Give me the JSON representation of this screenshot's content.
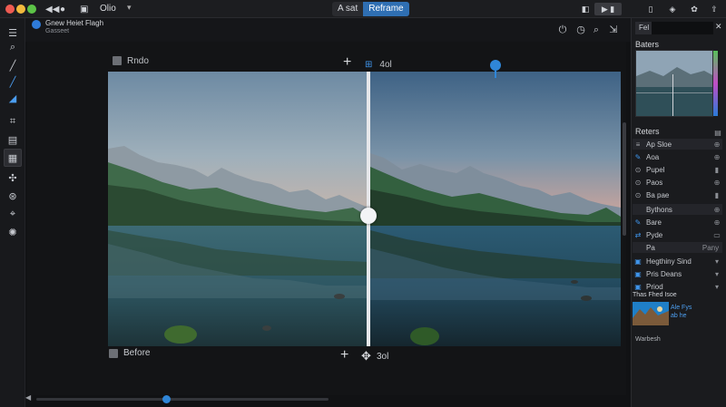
{
  "titlebar": {
    "app_name": "Olio",
    "segmented": [
      "A sat",
      "Reframe"
    ]
  },
  "document": {
    "title": "Gnew Heiet Flagh",
    "subtitle": "Gasseet"
  },
  "canvas": {
    "before_label_top": "Rndo",
    "after_label_top": "4ol",
    "before_label_bottom": "Before",
    "after_label_bottom": "3ol"
  },
  "right_panel": {
    "tab_label": "Fel",
    "panel_title": "Baters",
    "section_title": "Reters",
    "rows": [
      {
        "icon": "≡",
        "label": "Ap Sloe",
        "right": "⊕"
      },
      {
        "icon": "✎",
        "label": "Aoa",
        "right": "⊕"
      },
      {
        "icon": "⊙",
        "label": "Pupel",
        "right": "▮"
      },
      {
        "icon": "⊙",
        "label": "Paos",
        "right": "⊕"
      },
      {
        "icon": "⊙",
        "label": "Ba pae",
        "right": "▮"
      },
      {
        "icon": "",
        "label": "Bythons",
        "right": "⊕"
      },
      {
        "icon": "✎",
        "label": "Bare",
        "right": "⊕"
      },
      {
        "icon": "⇄",
        "label": "Pyde",
        "right": "▭"
      },
      {
        "icon": "",
        "label": "Pa",
        "right": "Pany"
      },
      {
        "icon": "▣",
        "label": "Hegthiny Sind",
        "right": "▾"
      },
      {
        "icon": "▣",
        "label": "Pris Deans",
        "right": "▾"
      },
      {
        "icon": "▣",
        "label": "Priod",
        "right": "▾"
      }
    ],
    "layer_badge": "Thas Fhed Isoe",
    "layer_name": "Ale Fys",
    "layer_sub": "ab he",
    "bottom_label": "Warbesh"
  },
  "colors": {
    "accent": "#2f86d8",
    "background": "#111214"
  }
}
